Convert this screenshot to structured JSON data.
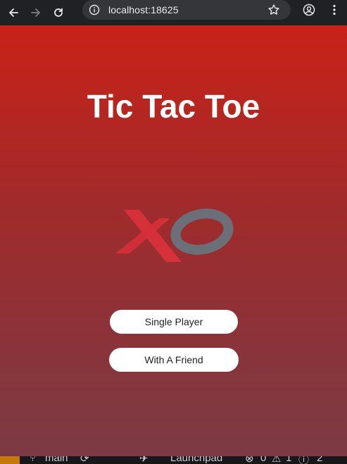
{
  "browser": {
    "url": "localhost:18625"
  },
  "app": {
    "title": "Tic Tac Toe",
    "logo_x": "X",
    "logo_o": "O",
    "buttons": {
      "single_player": "Single Player",
      "with_friend": "With A Friend"
    }
  },
  "statusbar": {
    "branch": "main",
    "launchpad": "Launchpad",
    "errors": "0",
    "warnings": "1",
    "info": "2"
  },
  "colors": {
    "gradient_top": "#c92218",
    "gradient_bottom": "#7c3b44",
    "logo_x": "#d6303b",
    "logo_o": "#6b7078",
    "button_bg": "#ffffff"
  }
}
